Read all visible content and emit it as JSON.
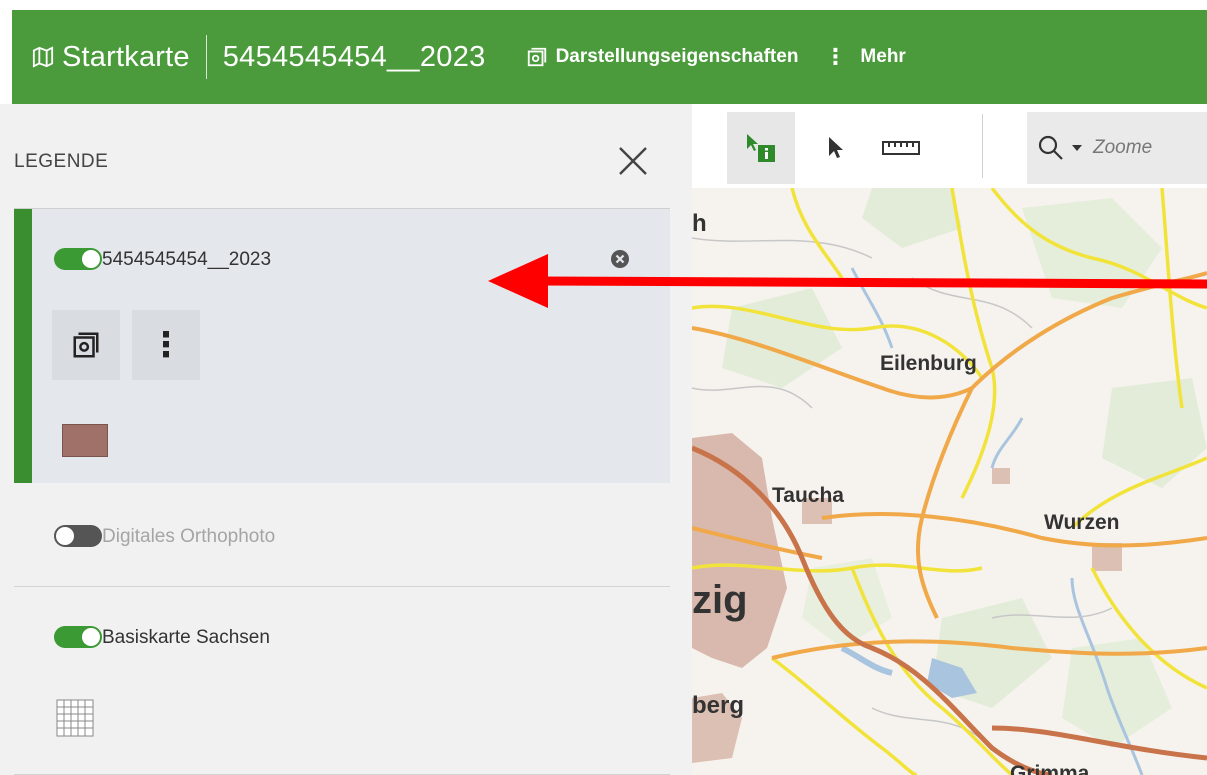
{
  "topbar": {
    "app_title": "Startkarte",
    "project_title": "5454545454__2023",
    "display_properties_label": "Darstellungseigenschaften",
    "more_label": "Mehr",
    "more_glyph": "⋮"
  },
  "legend": {
    "title": "LEGENDE",
    "close_glyph": "×",
    "layers": [
      {
        "name": "5454545454__2023",
        "visible": true,
        "swatch_color": "#a07168"
      },
      {
        "name": "Digitales Orthophoto",
        "visible": false
      },
      {
        "name": "Basiskarte Sachsen",
        "visible": true
      }
    ],
    "more_glyph": "⋮"
  },
  "map": {
    "search_placeholder": "Zoome",
    "labels": {
      "h": "h",
      "eilenburg": "Eilenburg",
      "taucha": "Taucha",
      "wurzen": "Wurzen",
      "zig": "zig",
      "berg": "berg",
      "grimma": "Grimma"
    }
  },
  "colors": {
    "accent": "#4b9a3b",
    "active_border": "#3b8e2f",
    "toggle_on": "#3c9a34",
    "annotation_arrow": "#ff0000"
  }
}
